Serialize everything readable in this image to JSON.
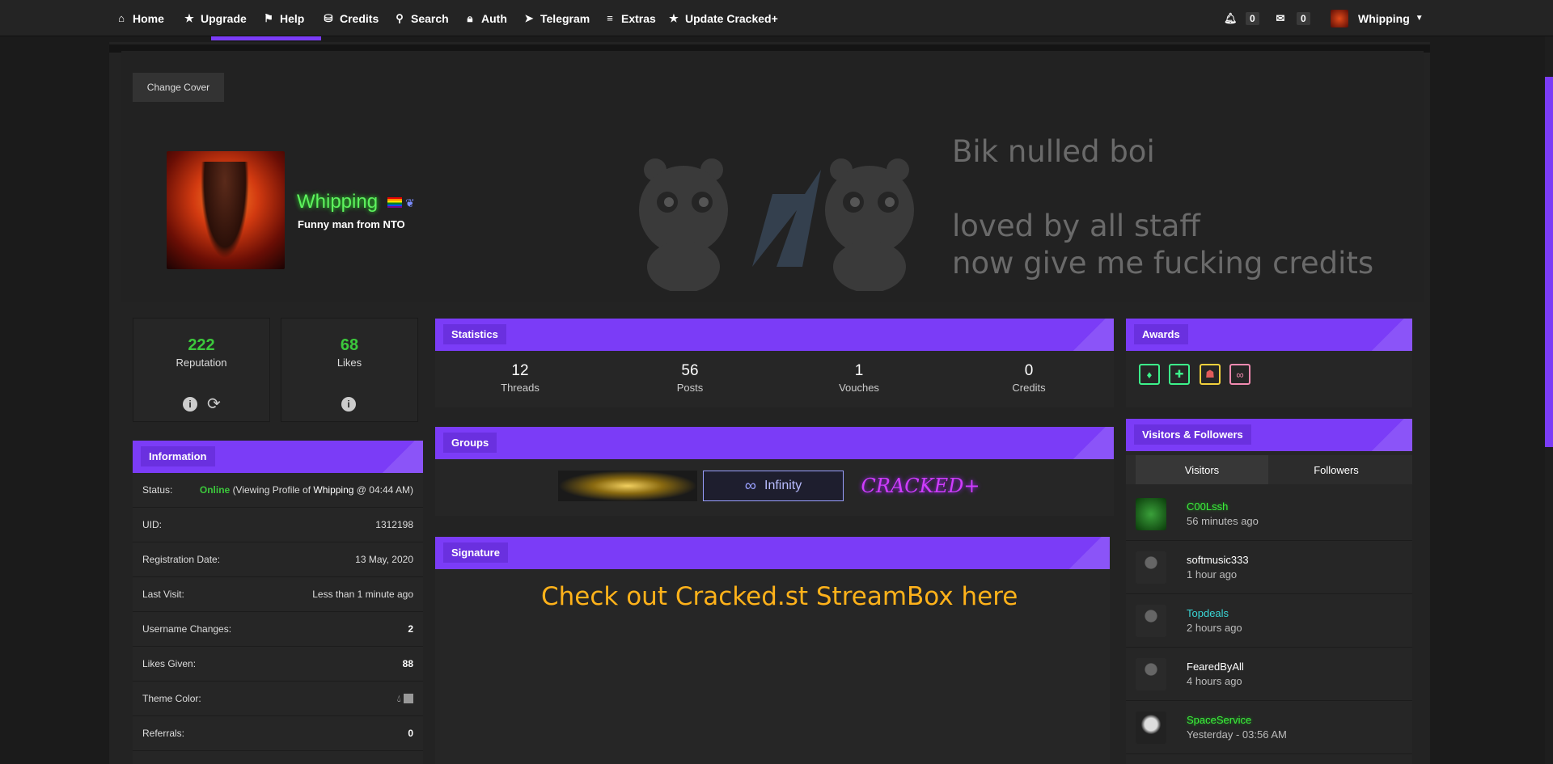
{
  "nav": {
    "items": [
      {
        "label": "Home",
        "icon": "home-icon"
      },
      {
        "label": "Upgrade",
        "icon": "star-icon"
      },
      {
        "label": "Help",
        "icon": "flag-icon"
      },
      {
        "label": "Credits",
        "icon": "coins-icon"
      },
      {
        "label": "Search",
        "icon": "search-icon"
      },
      {
        "label": "Auth",
        "icon": "lock-icon"
      },
      {
        "label": "Telegram",
        "icon": "telegram-icon"
      },
      {
        "label": "Extras",
        "icon": "menu-icon"
      },
      {
        "label": "Update Cracked+",
        "icon": "star-icon"
      }
    ],
    "notifications_count": "0",
    "inbox_count": "0",
    "user_menu_label": "Whipping"
  },
  "cover": {
    "change_cover_label": "Change Cover",
    "text_lines": [
      "Bik nulled boi",
      "loved by all staff",
      "now give me fucking credits"
    ]
  },
  "profile": {
    "username": "Whipping",
    "usertitle": "Funny man from NTO",
    "username_color": "#5ef25e"
  },
  "reputation": {
    "value": "222",
    "label": "Reputation"
  },
  "likes": {
    "value": "68",
    "label": "Likes"
  },
  "information": {
    "title": "Information",
    "status_label": "Status:",
    "status_online": "Online",
    "status_viewing_prefix": "(Viewing Profile of",
    "status_viewing_user": "Whipping",
    "status_viewing_suffix": "@ 04:44 AM)",
    "rows": [
      {
        "label": "UID:",
        "value": "1312198"
      },
      {
        "label": "Registration Date:",
        "value": "13 May, 2020"
      },
      {
        "label": "Last Visit:",
        "value": "Less than 1 minute ago"
      },
      {
        "label": "Username Changes:",
        "value": "2"
      },
      {
        "label": "Likes Given:",
        "value": "88"
      },
      {
        "label": "Theme Color:",
        "value": ""
      },
      {
        "label": "Referrals:",
        "value": "0"
      }
    ]
  },
  "statistics": {
    "title": "Statistics",
    "items": [
      {
        "value": "12",
        "label": "Threads"
      },
      {
        "value": "56",
        "label": "Posts"
      },
      {
        "value": "1",
        "label": "Vouches"
      },
      {
        "value": "0",
        "label": "Credits"
      }
    ]
  },
  "groups": {
    "title": "Groups",
    "infinity_label": "Infinity",
    "cracked_label": "CRACKED+"
  },
  "signature": {
    "title": "Signature",
    "text": "Check out Cracked.st StreamBox here"
  },
  "awards": {
    "title": "Awards"
  },
  "visitors_panel": {
    "title": "Visitors & Followers",
    "tab_visitors": "Visitors",
    "tab_followers": "Followers",
    "visitors": [
      {
        "name": "C00Lssh",
        "time": "56 minutes ago",
        "color": "#3cf23c"
      },
      {
        "name": "softmusic333",
        "time": "1 hour ago",
        "color": "#ffffff"
      },
      {
        "name": "Topdeals",
        "time": "2 hours ago",
        "color": "#3ad6d6"
      },
      {
        "name": "FearedByAll",
        "time": "4 hours ago",
        "color": "#ffffff"
      },
      {
        "name": "SpaceService",
        "time": "Yesterday - 03:56 AM",
        "color": "#3cf23c"
      }
    ]
  },
  "colors": {
    "accent": "#7b3cf7",
    "online": "#3cc83c",
    "signature": "#ffb21a"
  }
}
